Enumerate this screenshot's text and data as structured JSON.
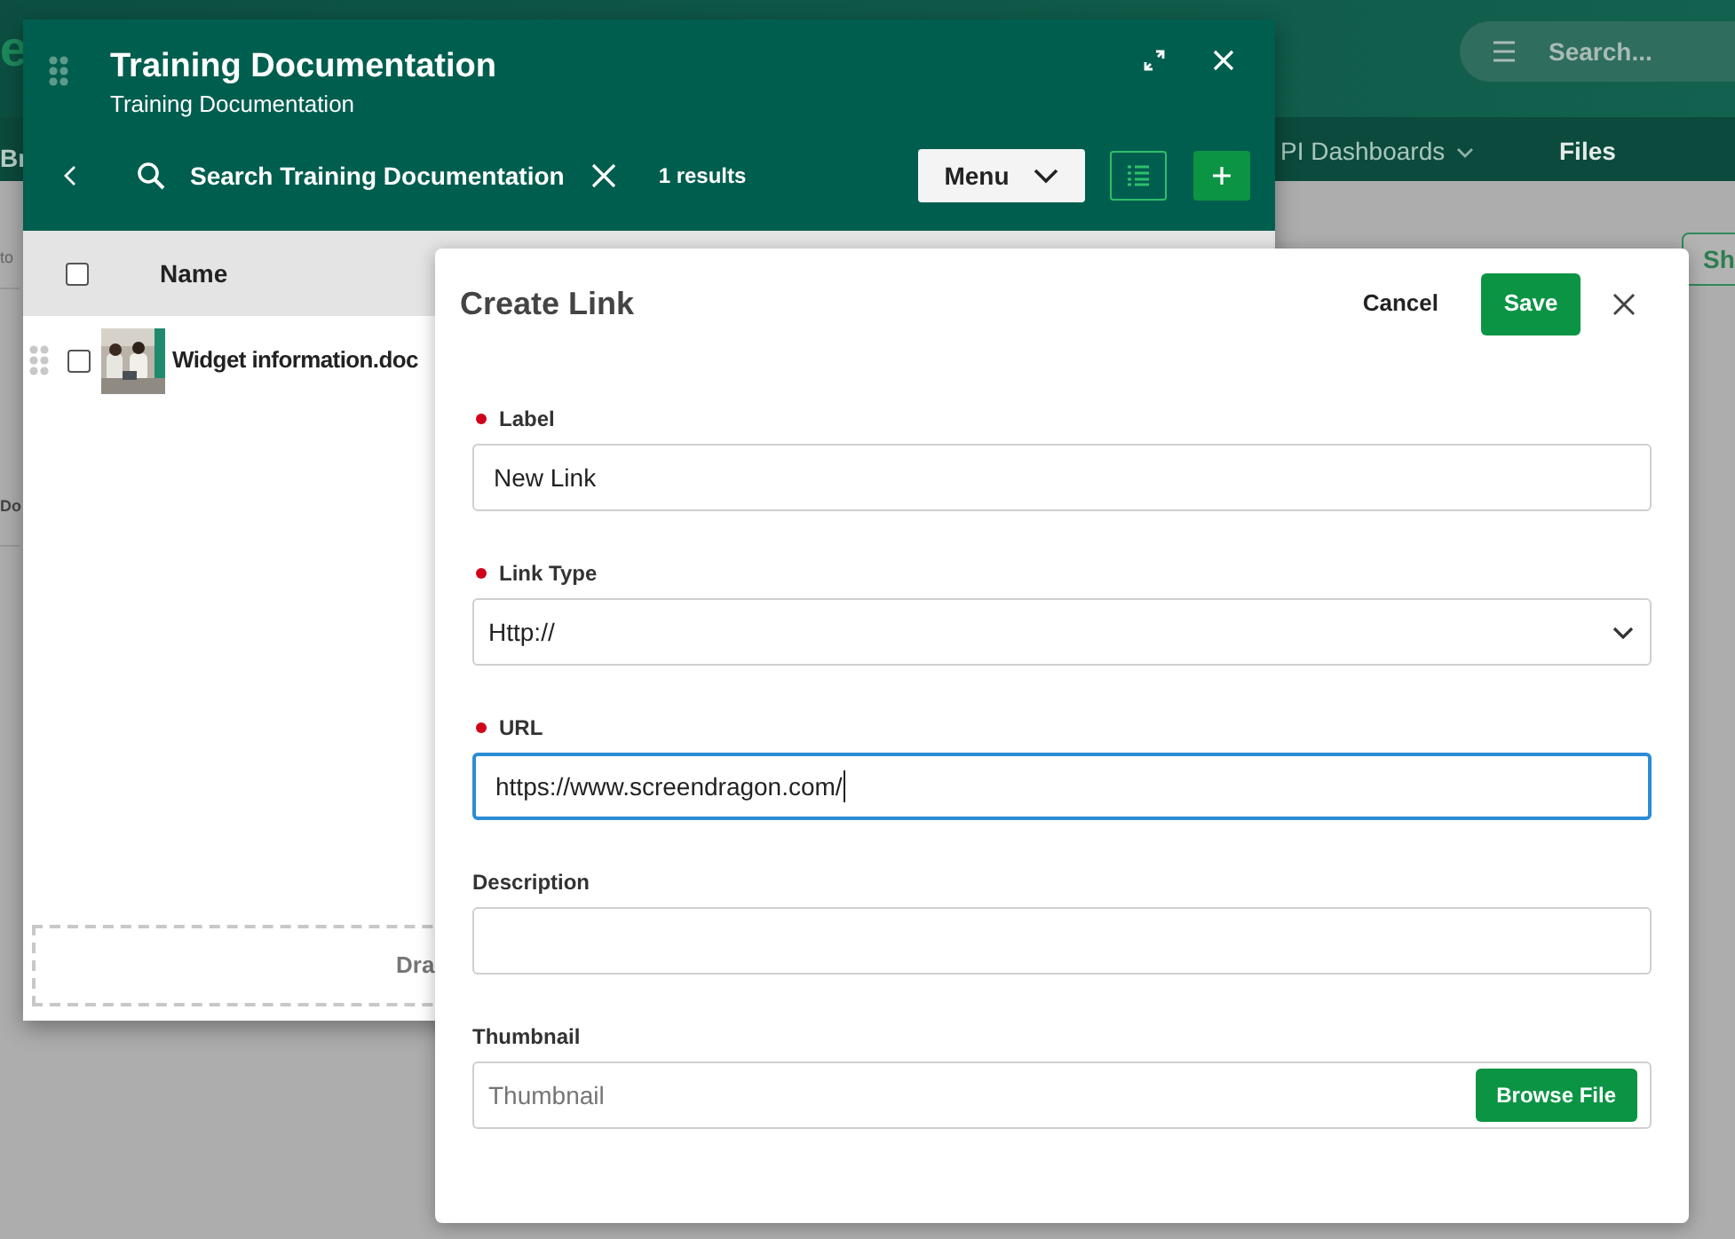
{
  "background_app": {
    "logo_fragment": "e",
    "search": {
      "placeholder": "Search..."
    },
    "nav": [
      {
        "label": "Br",
        "has_caret": false
      },
      {
        "label": "PI Dashboards",
        "has_caret": true
      },
      {
        "label": "Files",
        "has_caret": false
      }
    ],
    "fragments": [
      "to",
      "Do"
    ],
    "button_fragment": "Sh"
  },
  "panel": {
    "title": "Training Documentation",
    "subtitle": "Training Documentation",
    "search": {
      "value": "Search Training Documentation"
    },
    "results": "1 results",
    "menu_button": "Menu",
    "table": {
      "columns": [
        "Name"
      ],
      "header_checked": false,
      "rows": [
        {
          "name": "Widget information.doc",
          "checked": false
        }
      ]
    },
    "dropzone": "Dra"
  },
  "dialog": {
    "title": "Create Link",
    "cancel": "Cancel",
    "save": "Save",
    "fields": [
      {
        "kind": "text",
        "label": "Label",
        "required": true,
        "value": "New Link",
        "focused": false
      },
      {
        "kind": "select",
        "label": "Link Type",
        "required": true,
        "value": "Http://",
        "focused": false
      },
      {
        "kind": "text",
        "label": "URL",
        "required": true,
        "value": "https://www.screendragon.com/",
        "focused": true
      },
      {
        "kind": "text",
        "label": "Description",
        "required": false,
        "focused": false
      },
      {
        "kind": "file",
        "label": "Thumbnail",
        "required": false,
        "placeholder": "Thumbnail",
        "button": "Browse File",
        "focused": false
      }
    ]
  }
}
